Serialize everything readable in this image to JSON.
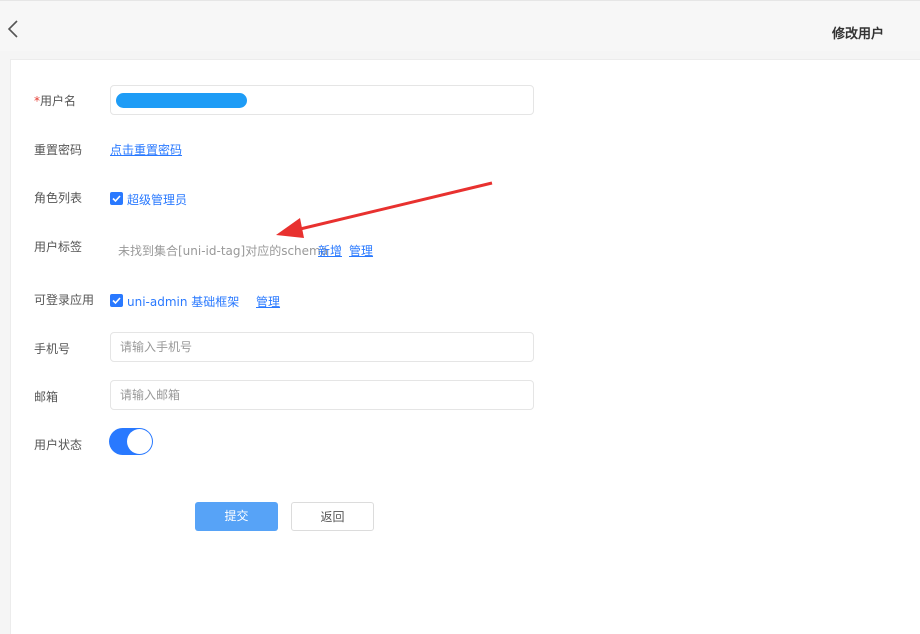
{
  "nav": {
    "title": "修改用户",
    "back_icon": "chevron-left-icon"
  },
  "form": {
    "username": {
      "required_mark": "*",
      "label": "用户名"
    },
    "reset_password": {
      "label": "重置密码",
      "link": "点击重置密码"
    },
    "roles": {
      "label": "角色列表",
      "options": [
        {
          "label": "超级管理员",
          "checked": true
        }
      ]
    },
    "tags": {
      "label": "用户标签",
      "hint": "未找到集合[uni-id-tag]对应的schema",
      "add_link": "新增",
      "manage_link": "管理"
    },
    "apps": {
      "label": "可登录应用",
      "options": [
        {
          "label": "uni-admin 基础框架",
          "checked": true
        }
      ],
      "manage_link": "管理"
    },
    "mobile": {
      "label": "手机号",
      "placeholder": "请输入手机号",
      "value": ""
    },
    "email": {
      "label": "邮箱",
      "placeholder": "请输入邮箱",
      "value": ""
    },
    "status": {
      "label": "用户状态",
      "enabled": true
    }
  },
  "buttons": {
    "submit": "提交",
    "back": "返回"
  },
  "colors": {
    "accent": "#2979ff",
    "submit_bg": "#57a3f7",
    "annotation_arrow": "#e8312f"
  }
}
